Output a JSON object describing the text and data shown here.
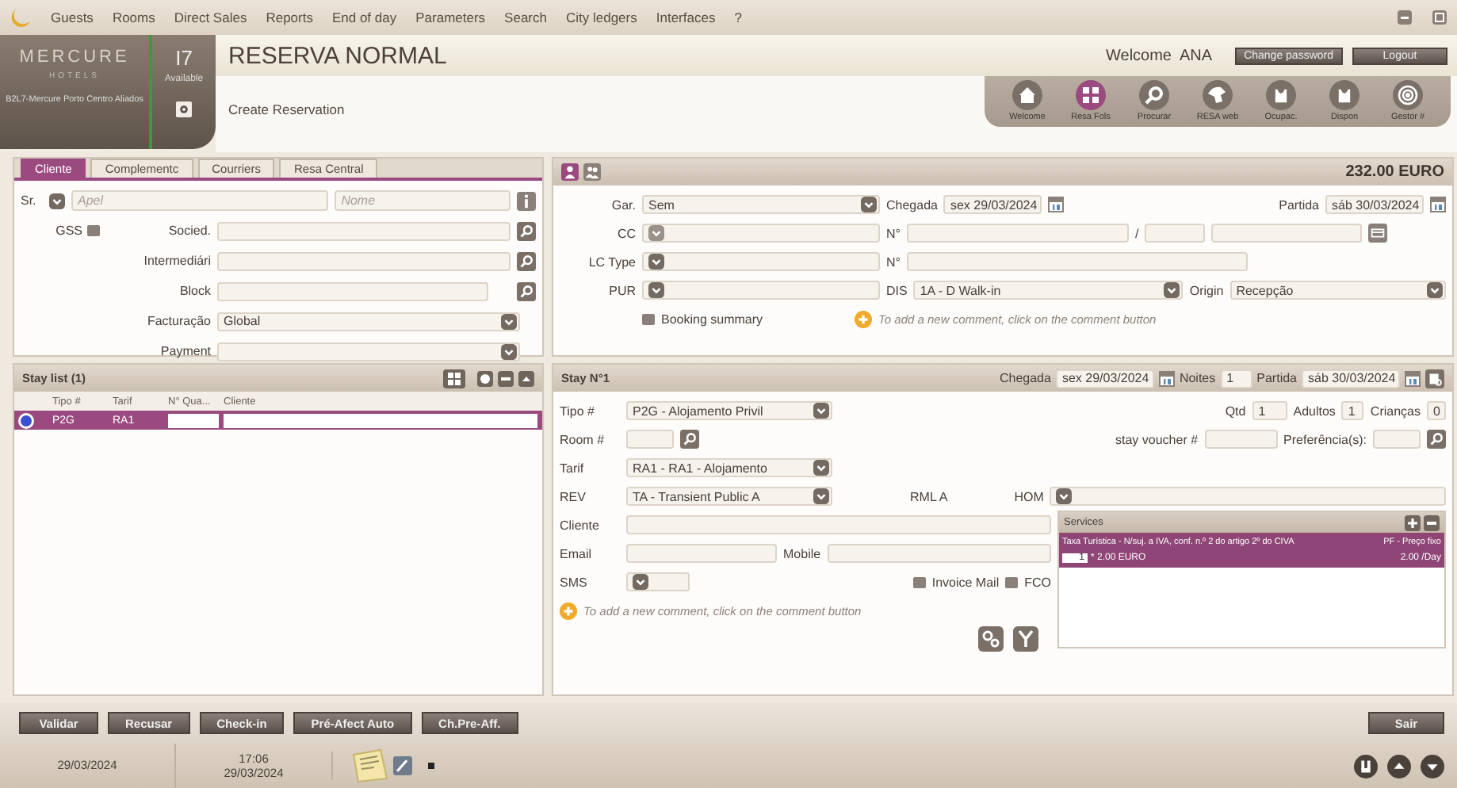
{
  "menu": {
    "items": [
      "Guests",
      "Rooms",
      "Direct Sales",
      "Reports",
      "End of day",
      "Parameters",
      "Search",
      "City ledgers",
      "Interfaces",
      "?"
    ]
  },
  "hotel": {
    "brand": "MERCURE",
    "sub": "HOTELS",
    "count": "I7",
    "count_label": "Available",
    "name": "B2L7-Mercure Porto Centro Aliados"
  },
  "header": {
    "title": "RESERVA NORMAL",
    "subtitle": "Create Reservation",
    "welcome": "Welcome",
    "user": "ANA",
    "buttons": [
      "Change password",
      "Logout"
    ]
  },
  "toolbar": [
    {
      "label": "Welcome",
      "kind": "home",
      "selected": false
    },
    {
      "label": "Resa Fols",
      "kind": "grid",
      "selected": true
    },
    {
      "label": "Procurar",
      "kind": "search",
      "selected": false
    },
    {
      "label": "RESA web",
      "kind": "globe",
      "selected": false
    },
    {
      "label": "Ocupac.",
      "kind": "bag",
      "selected": false
    },
    {
      "label": "Dispon",
      "kind": "bag",
      "selected": false
    },
    {
      "label": "Gestor #",
      "kind": "target",
      "selected": false
    }
  ],
  "client": {
    "tabs": [
      {
        "label": "Cliente",
        "selected": true
      },
      {
        "label": "Complementc",
        "selected": false
      },
      {
        "label": "Courriers",
        "selected": false
      },
      {
        "label": "Resa Central",
        "selected": false
      }
    ],
    "title": "Sr.",
    "surname": {
      "placeholder": "Apel"
    },
    "name": {
      "placeholder": "Nome"
    },
    "gss": {
      "label": "GSS",
      "checked": false
    },
    "fields": [
      {
        "label": "Socied.",
        "kind": "search"
      },
      {
        "label": "Intermediári",
        "kind": "search"
      },
      {
        "label": "Block",
        "kind": "search"
      },
      {
        "label": "Facturação",
        "kind": "select",
        "value": "Global"
      },
      {
        "label": "Payment",
        "kind": "select"
      }
    ]
  },
  "reservation": {
    "total": "232.00 EURO",
    "guarantee": {
      "label": "Gar.",
      "value": "Sem"
    },
    "arrival": {
      "label": "Chegada",
      "value": "sex 29/03/2024"
    },
    "departure": {
      "label": "Partida",
      "value": "sáb 30/03/2024"
    },
    "cc_label": "CC",
    "number_label": "N°",
    "separator": "/",
    "lc_type_label": "LC Type",
    "lc_number_label": "N°",
    "pur_label": "PUR",
    "dis": {
      "label": "DIS",
      "value": "1A - D Walk-in"
    },
    "origin": {
      "label": "Origin",
      "value": "Recepção"
    },
    "booking_summary": {
      "label": "Booking summary",
      "checked": false
    },
    "comment_hint": "To add a new comment, click on the comment button"
  },
  "stay_list": {
    "title": "Stay list (1)",
    "columns": [
      "Tipo #",
      "Tarif",
      "N° Qua...",
      "Cliente"
    ],
    "rows": [
      {
        "type": "P2G",
        "tarif": "RA1",
        "selected": true
      }
    ]
  },
  "stay": {
    "title": "Stay N°1",
    "arrival": {
      "label": "Chegada",
      "value": "sex 29/03/2024"
    },
    "nights": {
      "label": "Noites",
      "value": "1"
    },
    "departure": {
      "label": "Partida",
      "value": "sáb 30/03/2024"
    },
    "type": {
      "label": "Tipo #",
      "value": "P2G - Alojamento Privil"
    },
    "qty": {
      "label": "Qtd",
      "value": "1"
    },
    "adults": {
      "label": "Adultos",
      "value": "1"
    },
    "children": {
      "label": "Crianças",
      "value": "0"
    },
    "room_label": "Room #",
    "voucher_label": "stay voucher #",
    "preferences_label": "Preferência(s):",
    "tarif": {
      "label": "Tarif",
      "value": "RA1 - RA1 - Alojamento"
    },
    "rev": {
      "label": "REV",
      "value": "TA - Transient Public A"
    },
    "rml": "RML A",
    "hom_label": "HOM",
    "client_label": "Cliente",
    "email_label": "Email",
    "mobile_label": "Mobile",
    "sms_label": "SMS",
    "invoice_mail": {
      "label": "Invoice Mail",
      "checked": false
    },
    "fco": {
      "label": "FCO",
      "checked": false
    },
    "comment_hint": "To add a new comment, click on the comment button",
    "services": {
      "title": "Services",
      "rows": [
        {
          "name": "Taxa Turística - N/suj. a IVA, conf. n.º 2 do artigo 2º do CIVA",
          "type": "PF - Preço fixo",
          "qty": "1",
          "price": "* 2.00 EURO",
          "amount": "2.00",
          "unit": "/Day",
          "selected": true
        }
      ]
    }
  },
  "actions": [
    "Validar",
    "Recusar",
    "Check-in",
    "Pré-Afect Auto",
    "Ch.Pre-Aff."
  ],
  "exit": "Sair",
  "status_bar": {
    "date": "29/03/2024",
    "time": "17:06",
    "time_date": "29/03/2024"
  }
}
